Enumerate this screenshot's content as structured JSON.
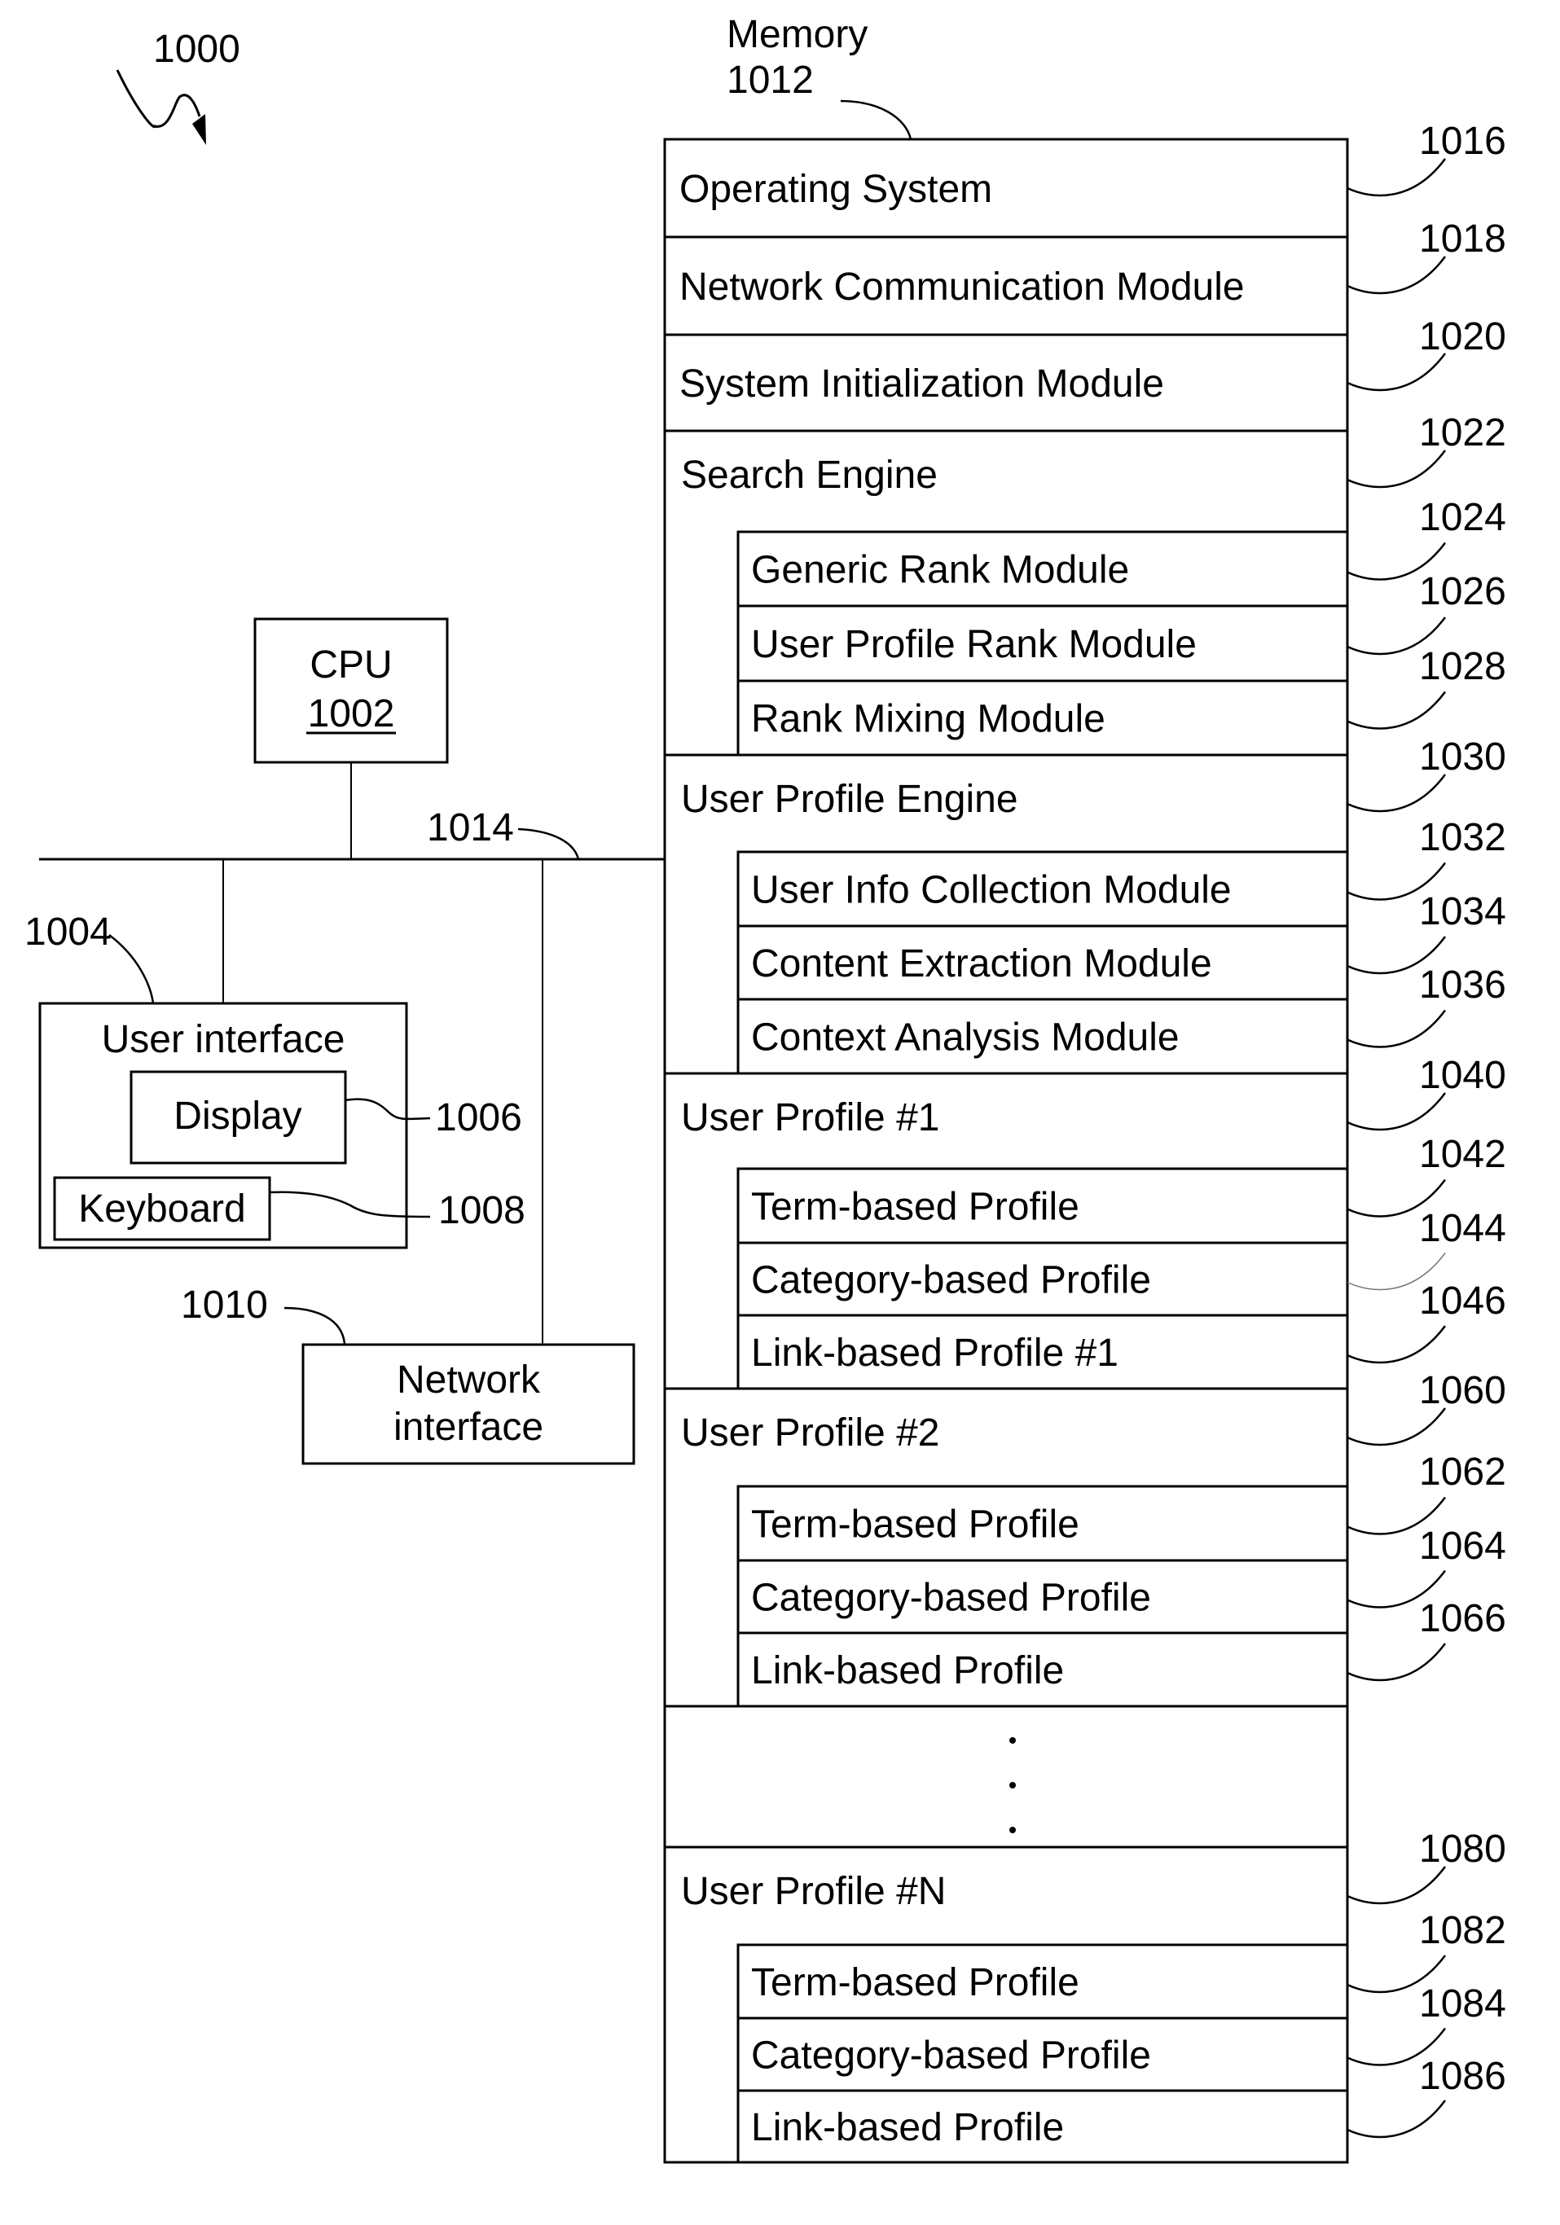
{
  "figure": {
    "ref": "1000"
  },
  "cpu": {
    "label": "CPU",
    "ref": "1002"
  },
  "bus": {
    "ref": "1014"
  },
  "user_interface": {
    "label": "User interface",
    "ref": "1004",
    "display": {
      "label": "Display",
      "ref": "1006"
    },
    "keyboard": {
      "label": "Keyboard",
      "ref": "1008"
    }
  },
  "network_interface": {
    "label_line1": "Network",
    "label_line2": "interface",
    "ref": "1010"
  },
  "memory": {
    "label": "Memory",
    "ref": "1012",
    "sections": [
      {
        "label": "Operating System",
        "ref": "1016",
        "children": []
      },
      {
        "label": "Network Communication Module",
        "ref": "1018",
        "children": []
      },
      {
        "label": "System Initialization Module",
        "ref": "1020",
        "children": []
      },
      {
        "label": "Search Engine",
        "ref": "1022",
        "children": [
          {
            "label": "Generic Rank Module",
            "ref": "1024"
          },
          {
            "label": "User Profile Rank Module",
            "ref": "1026"
          },
          {
            "label": "Rank Mixing Module",
            "ref": "1028"
          }
        ]
      },
      {
        "label": "User Profile Engine",
        "ref": "1030",
        "children": [
          {
            "label": "User Info Collection Module",
            "ref": "1032"
          },
          {
            "label": "Content Extraction Module",
            "ref": "1034"
          },
          {
            "label": "Context Analysis Module",
            "ref": "1036"
          }
        ]
      },
      {
        "label": "User Profile #1",
        "ref": "1040",
        "children": [
          {
            "label": "Term-based Profile",
            "ref": "1042"
          },
          {
            "label": "Category-based Profile",
            "ref": "1044"
          },
          {
            "label": "Link-based Profile #1",
            "ref": "1046"
          }
        ]
      },
      {
        "label": "User Profile #2",
        "ref": "1060",
        "children": [
          {
            "label": "Term-based Profile",
            "ref": "1062"
          },
          {
            "label": "Category-based Profile",
            "ref": "1064"
          },
          {
            "label": "Link-based Profile",
            "ref": "1066"
          }
        ]
      },
      {
        "label": "",
        "ref": "",
        "ellipsis": true,
        "children": []
      },
      {
        "label": "User Profile #N",
        "ref": "1080",
        "children": [
          {
            "label": "Term-based Profile",
            "ref": "1082"
          },
          {
            "label": "Category-based Profile",
            "ref": "1084"
          },
          {
            "label": "Link-based Profile",
            "ref": "1086"
          }
        ]
      }
    ]
  },
  "colors": {
    "line": "#000000",
    "background": "#ffffff",
    "faint_leader": "#777777"
  }
}
